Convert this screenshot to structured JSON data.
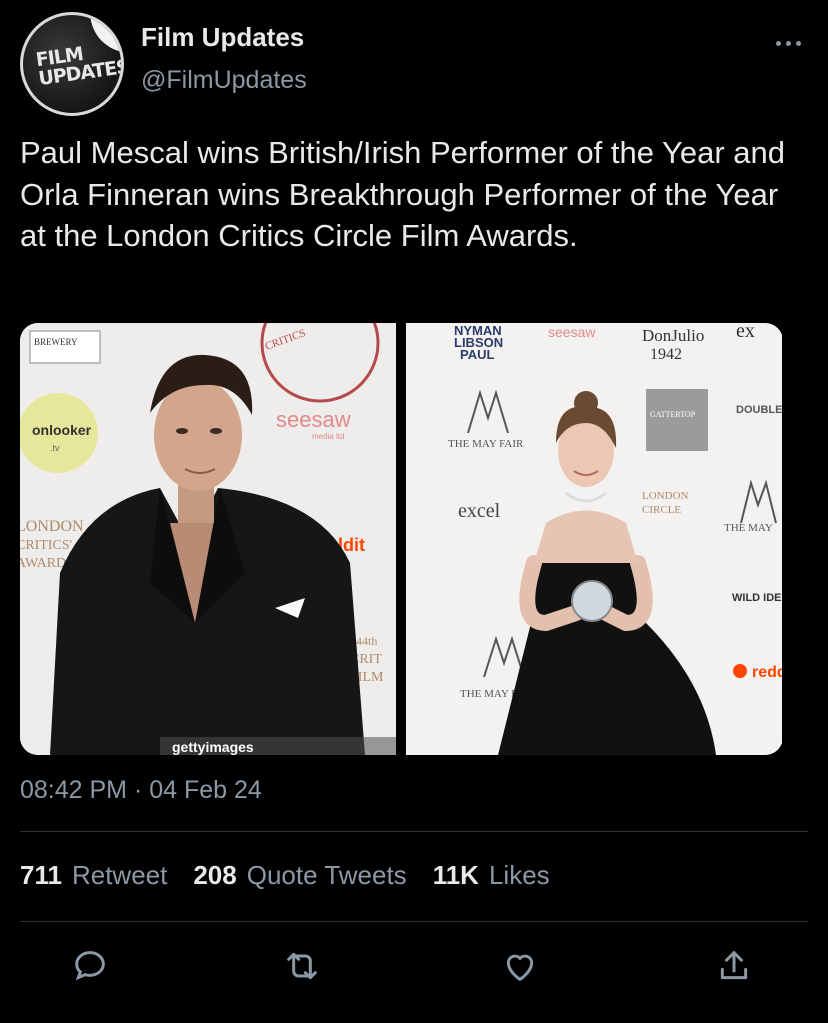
{
  "account": {
    "avatar_text_line1": "FILM",
    "avatar_text_line2": "UPDATES",
    "display_name": "Film Updates",
    "handle": "@FilmUpdates",
    "more_icon": "more-horizontal-icon"
  },
  "tweet": {
    "text": "Paul Mescal wins British/Irish Performer of the Year and Orla Finneran wins Breakthrough Performer of the Year at the London Critics Circle Film Awards.",
    "timestamp": "08:42 PM · 04 Feb 24"
  },
  "media": {
    "photo_left_watermark": "gettyimages",
    "backdrop_text": {
      "onlooker": "onlooker",
      "onlooker_tv": ".tv",
      "seesaw": "seesaw",
      "seesaw_sub": "media ltd",
      "brewery": "BREWERY",
      "critics": "CRITICS",
      "london": "LONDON",
      "critics_circle": "CRITICS' CIRCLE",
      "awards": "AWARDS",
      "reddit": "reddit",
      "film": "FILM",
      "nyman": "NYMAN",
      "libson": "LIBSON",
      "paul": "PAUL",
      "donjulio": "DonJulio",
      "year1942": "1942",
      "mayfair": "THE MAY FAIR",
      "gattertop": "GATTERTOP",
      "double_dutch": "DOUBLE DUTCH",
      "excel": "excel",
      "wild_idea": "WILD IDEA",
      "fortyfourth": "44th"
    }
  },
  "stats": {
    "retweets_count": "711",
    "retweets_label": "Retweet",
    "quotes_count": "208",
    "quotes_label": "Quote Tweets",
    "likes_count": "11K",
    "likes_label": "Likes"
  },
  "actions": [
    "reply-icon",
    "retweet-icon",
    "like-icon",
    "share-icon"
  ],
  "colors": {
    "background": "#000000",
    "text": "#e7e9ea",
    "secondary": "#8b98a5",
    "divider": "#2f3336"
  }
}
